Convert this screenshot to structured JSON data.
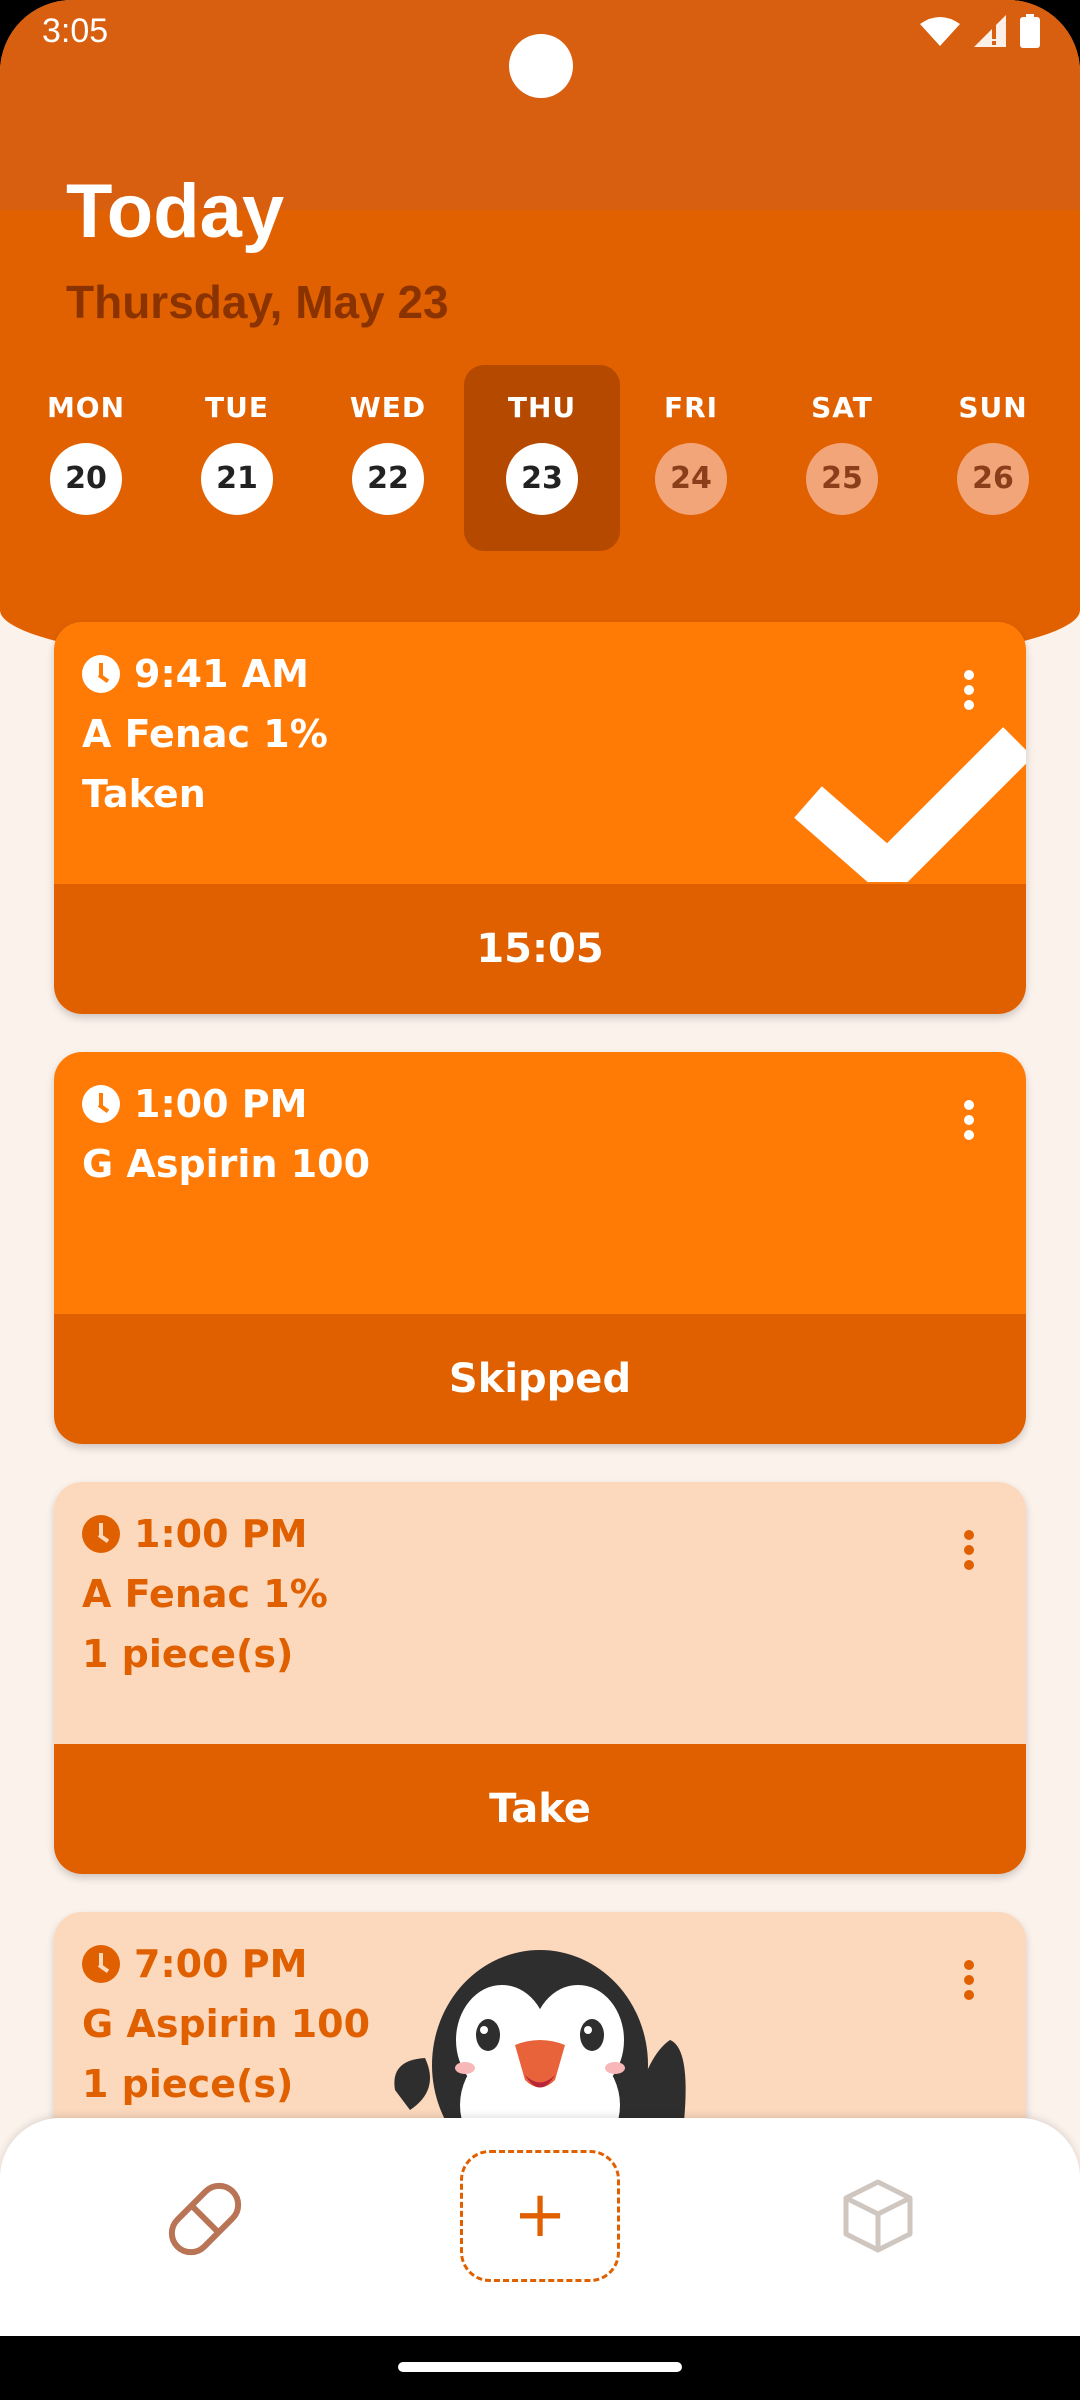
{
  "status_bar": {
    "time": "3:05"
  },
  "header": {
    "title": "Today",
    "date": "Thursday, May 23"
  },
  "week": [
    {
      "name": "MON",
      "num": "20",
      "state": "past"
    },
    {
      "name": "TUE",
      "num": "21",
      "state": "past"
    },
    {
      "name": "WED",
      "num": "22",
      "state": "past"
    },
    {
      "name": "THU",
      "num": "23",
      "state": "selected"
    },
    {
      "name": "FRI",
      "num": "24",
      "state": "future"
    },
    {
      "name": "SAT",
      "num": "25",
      "state": "future"
    },
    {
      "name": "SUN",
      "num": "26",
      "state": "future"
    }
  ],
  "doses": [
    {
      "time": "9:41 AM",
      "line1": "A Fenac 1%",
      "line2": "Taken",
      "action": "15:05",
      "style": "dark",
      "taken": true
    },
    {
      "time": "1:00 PM",
      "line1": "G Aspirin 100",
      "line2": "",
      "action": "Skipped",
      "style": "dark",
      "taken": false
    },
    {
      "time": "1:00 PM",
      "line1": "A Fenac 1%",
      "line2": "1 piece(s)",
      "action": "Take",
      "style": "light",
      "taken": false
    },
    {
      "time": "7:00 PM",
      "line1": "G Aspirin 100",
      "line2": "1 piece(s)",
      "action": "",
      "style": "light",
      "taken": false
    }
  ],
  "bottom_nav": {
    "left_icon": "pill-icon",
    "center_label": "+",
    "right_icon": "box-icon"
  },
  "colors": {
    "brand": "#E16100",
    "card_dark": "#FF7B06",
    "card_light": "#FCD8BD",
    "action": "#E06000"
  }
}
